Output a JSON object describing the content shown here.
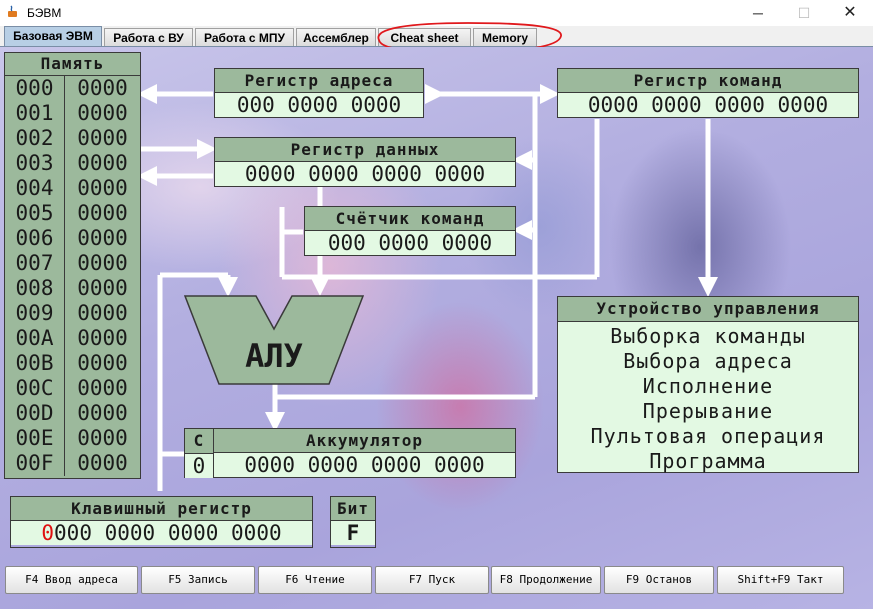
{
  "window": {
    "title": "БЭВМ",
    "min_glyph": "─",
    "max_glyph": "☐",
    "close_glyph": "✕"
  },
  "tabs": [
    {
      "label": "Базовая ЭВМ",
      "active": true
    },
    {
      "label": "Работа с ВУ",
      "active": false
    },
    {
      "label": "Работа с МПУ",
      "active": false
    },
    {
      "label": "Ассемблер",
      "active": false
    },
    {
      "label": "Cheat sheet",
      "active": false
    },
    {
      "label": "Memory",
      "active": false
    }
  ],
  "memory": {
    "title": "Память",
    "rows": [
      {
        "addr": "000",
        "value": "0000"
      },
      {
        "addr": "001",
        "value": "0000"
      },
      {
        "addr": "002",
        "value": "0000"
      },
      {
        "addr": "003",
        "value": "0000"
      },
      {
        "addr": "004",
        "value": "0000"
      },
      {
        "addr": "005",
        "value": "0000"
      },
      {
        "addr": "006",
        "value": "0000"
      },
      {
        "addr": "007",
        "value": "0000"
      },
      {
        "addr": "008",
        "value": "0000"
      },
      {
        "addr": "009",
        "value": "0000"
      },
      {
        "addr": "00A",
        "value": "0000"
      },
      {
        "addr": "00B",
        "value": "0000"
      },
      {
        "addr": "00C",
        "value": "0000"
      },
      {
        "addr": "00D",
        "value": "0000"
      },
      {
        "addr": "00E",
        "value": "0000"
      },
      {
        "addr": "00F",
        "value": "0000"
      }
    ]
  },
  "registers": {
    "address": {
      "title": "Регистр адреса",
      "value": "000 0000 0000"
    },
    "data": {
      "title": "Регистр данных",
      "value": "0000 0000 0000 0000"
    },
    "counter": {
      "title": "Счётчик команд",
      "value": "000 0000 0000"
    },
    "command": {
      "title": "Регистр команд",
      "value": "0000 0000 0000 0000"
    },
    "accumulator": {
      "title": "Аккумулятор",
      "value": "0000 0000 0000 0000"
    },
    "carry": {
      "title": "C",
      "value": "0"
    },
    "keyboard": {
      "title": "Клавишный регистр",
      "first_digit": "0",
      "rest": "000 0000 0000 0000"
    },
    "bit": {
      "title": "Бит",
      "value": "F"
    }
  },
  "alu": {
    "label": "АЛУ"
  },
  "control_unit": {
    "title": "Устройство управления",
    "items": [
      "Выборка команды",
      "Выбора адреса",
      "Исполнение",
      "Прерывание",
      "Пультовая операция",
      "Программа"
    ]
  },
  "buttons": [
    "F4 Ввод адреса",
    "F5 Запись",
    "F6 Чтение",
    "F7 Пуск",
    "F8 Продолжение",
    "F9 Останов",
    "Shift+F9 Такт"
  ],
  "colors": {
    "header_bg": "#9cb99c",
    "value_bg": "#e3f9e3",
    "wire": "#ffffff",
    "highlight_ellipse": "#e0181c",
    "keyboard_first_digit": "#e01010"
  }
}
